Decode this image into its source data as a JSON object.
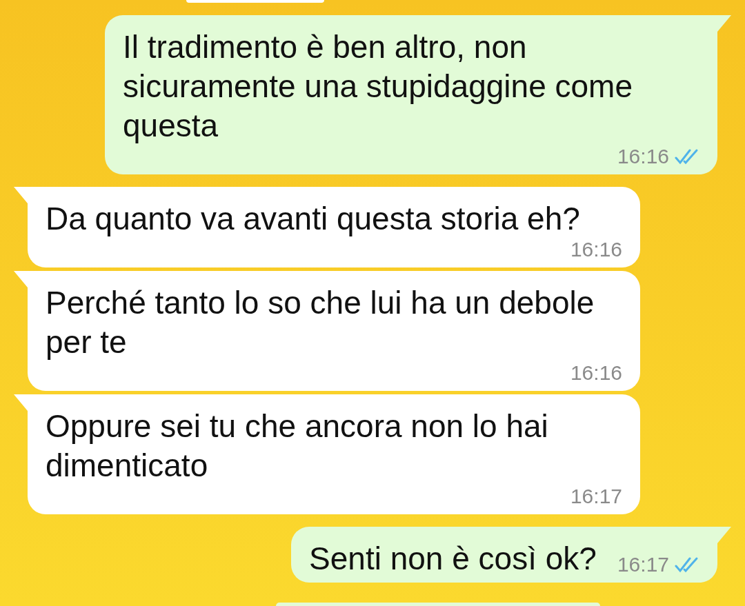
{
  "messages": [
    {
      "kind": "sent",
      "text": "Il tradimento è ben altro, non sicuramente una stupidaggine come questa",
      "time": "16:16",
      "read": true
    },
    {
      "kind": "received",
      "text": "Da quanto va avanti questa storia eh?",
      "time": "16:16"
    },
    {
      "kind": "received",
      "text": "Perché tanto lo so che lui ha un debole per te",
      "time": "16:16"
    },
    {
      "kind": "received",
      "text": "Oppure sei tu che ancora non lo hai dimenticato",
      "time": "16:17"
    },
    {
      "kind": "sent",
      "text": "Senti non è così ok?",
      "time": "16:17",
      "read": true
    }
  ]
}
